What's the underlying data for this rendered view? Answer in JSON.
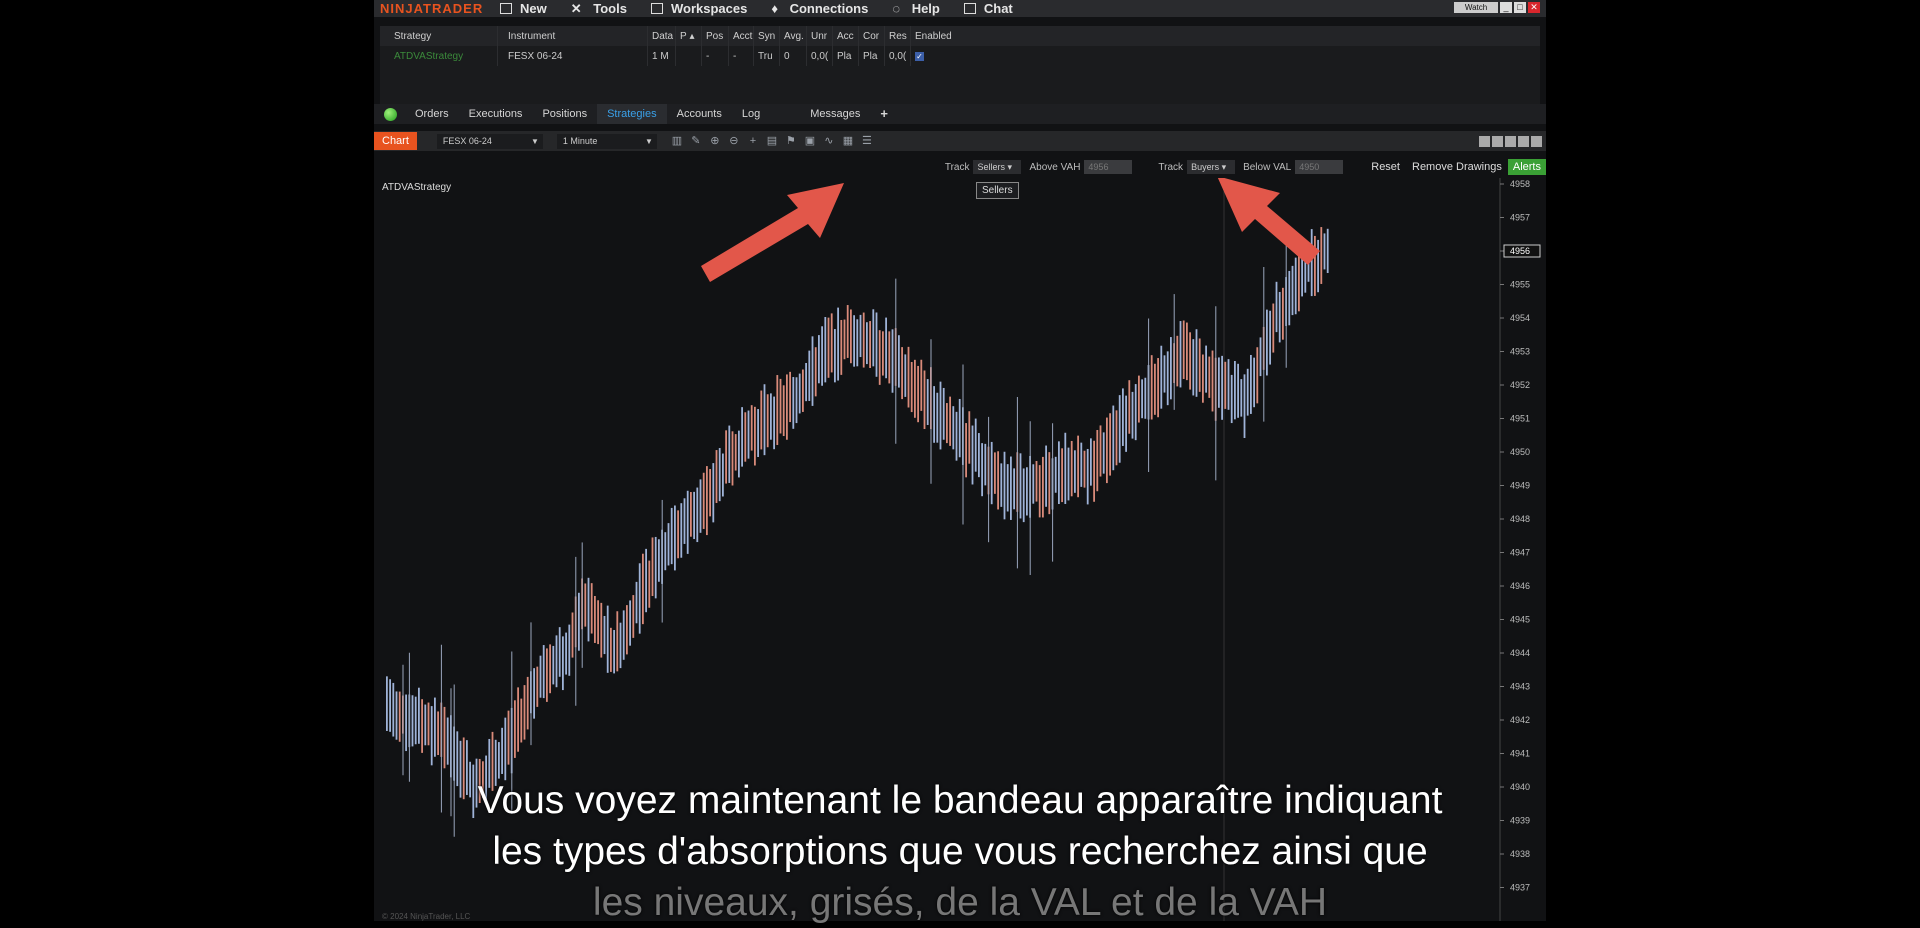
{
  "app": {
    "logo": "NINJATRADER",
    "menu": [
      {
        "label": "New",
        "icon": "window-icon"
      },
      {
        "label": "Tools",
        "icon": "tools-icon"
      },
      {
        "label": "Workspaces",
        "icon": "workspaces-icon"
      },
      {
        "label": "Connections",
        "icon": "connections-icon"
      },
      {
        "label": "Help",
        "icon": "help-icon"
      },
      {
        "label": "Chat",
        "icon": "chat-icon"
      }
    ],
    "watch_label": "Watch"
  },
  "strategies_grid": {
    "headers": [
      "Strategy",
      "Instrument",
      "Data",
      "P",
      "Pos",
      "Acct",
      "Syn",
      "Avg.",
      "Unr",
      "Acc",
      "Cor",
      "Res",
      "Enabled"
    ],
    "rows": [
      {
        "strategy": "ATDVAStrategy",
        "instrument": "FESX 06-24",
        "data": "1 M",
        "p": "",
        "pos": "-",
        "acct": "-",
        "syn": "Tru",
        "avg": "0",
        "unr": "0,0(",
        "acc": "Pla",
        "cor": "Pla",
        "res": "0,0(",
        "enabled": true
      }
    ]
  },
  "tabs": [
    "Orders",
    "Executions",
    "Positions",
    "Strategies",
    "Accounts",
    "Log",
    "Messages",
    "+"
  ],
  "active_tab": "Strategies",
  "chart_toolbar": {
    "chart_tab": "Chart",
    "instrument": "FESX 06-24",
    "interval": "1 Minute"
  },
  "options_bar": {
    "track1_label": "Track",
    "track1_value": "Sellers",
    "above_label": "Above VAH",
    "above_value": "4956",
    "track2_label": "Track",
    "track2_value": "Buyers",
    "below_label": "Below VAL",
    "below_value": "4950",
    "reset": "Reset",
    "remove": "Remove Drawings",
    "alerts": "Alerts"
  },
  "tooltip": "Sellers",
  "chart": {
    "strategy_label": "ATDVAStrategy",
    "copyright": "© 2024 NinjaTrader, LLC",
    "price_labels": [
      "4958",
      "4957",
      "4956",
      "4955",
      "4954",
      "4953",
      "4952",
      "4951",
      "4950",
      "4949",
      "4948",
      "4947",
      "4946",
      "4945",
      "4944",
      "4943",
      "4942",
      "4941",
      "4940",
      "4939",
      "4938",
      "4937"
    ],
    "current_price": "4956"
  },
  "colors": {
    "accent": "#e8531f",
    "up": "#9fb3d8",
    "down": "#d98a7a",
    "active_tab": "#3aa0e8",
    "alerts": "#3aa035"
  },
  "subtitles": [
    "Vous voyez maintenant le bandeau apparaître indiquant",
    "les types d'absorptions que vous recherchez ainsi que",
    "les niveaux, grisés, de la VAL et de la VAH"
  ]
}
